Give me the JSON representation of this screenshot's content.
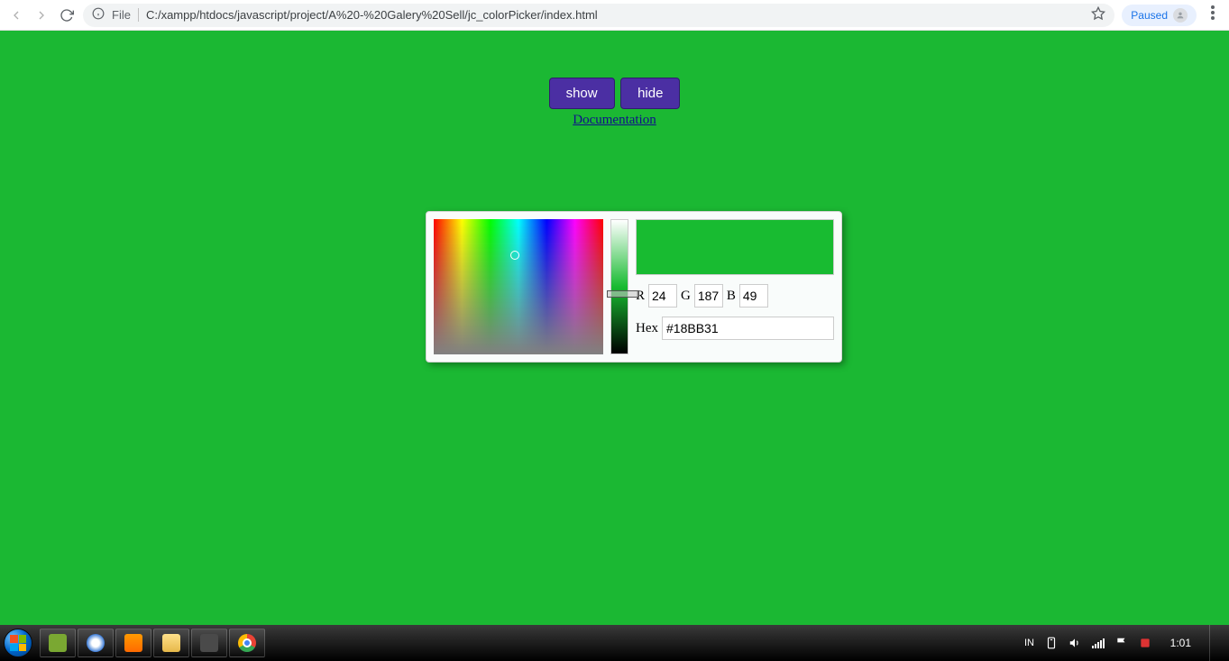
{
  "browser": {
    "file_label": "File",
    "url": "C:/xampp/htdocs/javascript/project/A%20-%20Galery%20Sell/jc_colorPicker/index.html",
    "paused_label": "Paused"
  },
  "controls": {
    "show_label": "show",
    "hide_label": "hide",
    "doc_link": "Documentation"
  },
  "picker": {
    "r_label": "R",
    "g_label": "G",
    "b_label": "B",
    "hex_label": "Hex",
    "r_value": "24",
    "g_value": "187",
    "b_value": "49",
    "hex_value": "#18BB31",
    "swatch_color": "#18bb31"
  },
  "taskbar": {
    "lang": "IN",
    "clock": "1:01"
  }
}
